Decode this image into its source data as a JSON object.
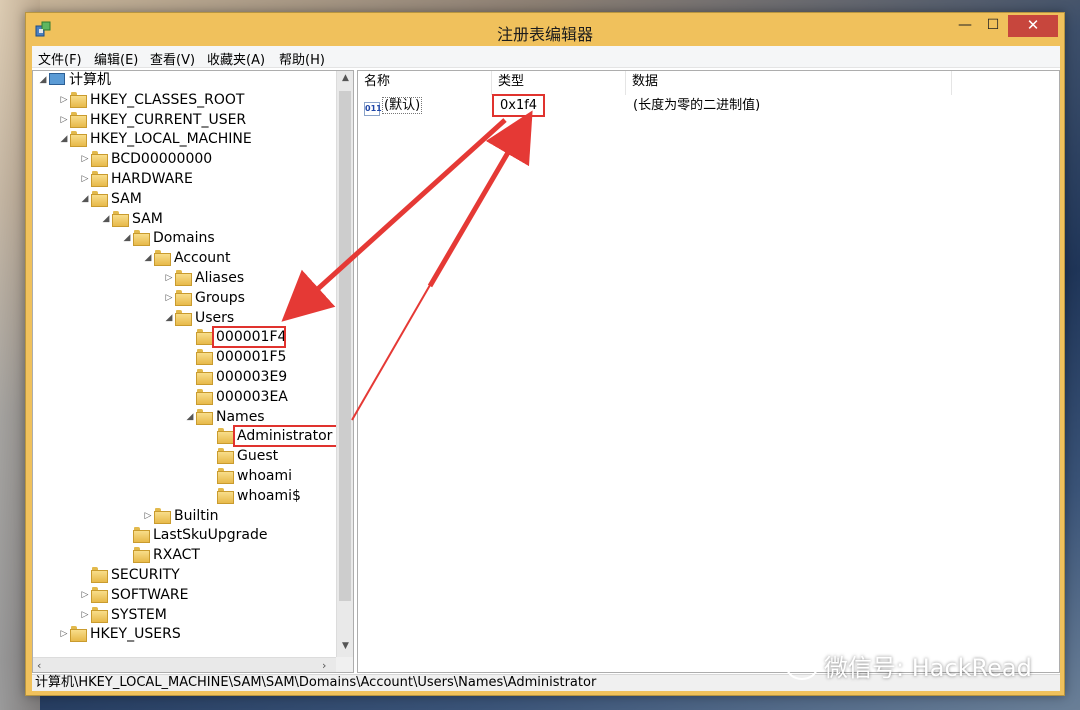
{
  "window": {
    "title": "注册表编辑器",
    "controls": {
      "minimize": "—",
      "maximize": "☐",
      "close": "✕"
    }
  },
  "menu": {
    "items": [
      "文件(F)",
      "编辑(E)",
      "查看(V)",
      "收藏夹(A)",
      "帮助(H)"
    ]
  },
  "tree": {
    "nodes": [
      {
        "label": "计算机",
        "level": 0,
        "expander": "◢",
        "icon": "computer-icon"
      },
      {
        "label": "HKEY_CLASSES_ROOT",
        "level": 1,
        "expander": "▷",
        "icon": "folder-icon"
      },
      {
        "label": "HKEY_CURRENT_USER",
        "level": 1,
        "expander": "▷",
        "icon": "folder-icon"
      },
      {
        "label": "HKEY_LOCAL_MACHINE",
        "level": 1,
        "expander": "◢",
        "icon": "folder-icon"
      },
      {
        "label": "BCD00000000",
        "level": 2,
        "expander": "▷",
        "icon": "folder-icon"
      },
      {
        "label": "HARDWARE",
        "level": 2,
        "expander": "▷",
        "icon": "folder-icon"
      },
      {
        "label": "SAM",
        "level": 2,
        "expander": "◢",
        "icon": "folder-icon"
      },
      {
        "label": "SAM",
        "level": 3,
        "expander": "◢",
        "icon": "folder-icon"
      },
      {
        "label": "Domains",
        "level": 4,
        "expander": "◢",
        "icon": "folder-icon"
      },
      {
        "label": "Account",
        "level": 5,
        "expander": "◢",
        "icon": "folder-icon"
      },
      {
        "label": "Aliases",
        "level": 6,
        "expander": "▷",
        "icon": "folder-icon"
      },
      {
        "label": "Groups",
        "level": 6,
        "expander": "▷",
        "icon": "folder-icon"
      },
      {
        "label": "Users",
        "level": 6,
        "expander": "◢",
        "icon": "folder-icon"
      },
      {
        "label": "000001F4",
        "level": 7,
        "expander": "",
        "icon": "folder-icon",
        "highlighted": true
      },
      {
        "label": "000001F5",
        "level": 7,
        "expander": "",
        "icon": "folder-icon"
      },
      {
        "label": "000003E9",
        "level": 7,
        "expander": "",
        "icon": "folder-icon"
      },
      {
        "label": "000003EA",
        "level": 7,
        "expander": "",
        "icon": "folder-icon"
      },
      {
        "label": "Names",
        "level": 7,
        "expander": "◢",
        "icon": "folder-icon"
      },
      {
        "label": "Administrator",
        "level": 8,
        "expander": "",
        "icon": "folder-icon",
        "highlighted": true,
        "selected": true
      },
      {
        "label": "Guest",
        "level": 8,
        "expander": "",
        "icon": "folder-icon"
      },
      {
        "label": "whoami",
        "level": 8,
        "expander": "",
        "icon": "folder-icon"
      },
      {
        "label": "whoami$",
        "level": 8,
        "expander": "",
        "icon": "folder-icon"
      },
      {
        "label": "Builtin",
        "level": 5,
        "expander": "▷",
        "icon": "folder-icon"
      },
      {
        "label": "LastSkuUpgrade",
        "level": 4,
        "expander": "",
        "icon": "folder-icon"
      },
      {
        "label": "RXACT",
        "level": 4,
        "expander": "",
        "icon": "folder-icon"
      },
      {
        "label": "SECURITY",
        "level": 2,
        "expander": "",
        "icon": "folder-icon"
      },
      {
        "label": "SOFTWARE",
        "level": 2,
        "expander": "▷",
        "icon": "folder-icon"
      },
      {
        "label": "SYSTEM",
        "level": 2,
        "expander": "▷",
        "icon": "folder-icon"
      },
      {
        "label": "HKEY_USERS",
        "level": 1,
        "expander": "▷",
        "icon": "folder-icon"
      }
    ]
  },
  "list": {
    "columns": [
      "名称",
      "类型",
      "数据"
    ],
    "rows": [
      {
        "name": "(默认)",
        "type": "0x1f4",
        "data": "(长度为零的二进制值)",
        "icon": "ab-icon",
        "icon_text": "011"
      }
    ]
  },
  "statusbar": {
    "path": "计算机\\HKEY_LOCAL_MACHINE\\SAM\\SAM\\Domains\\Account\\Users\\Names\\Administrator"
  },
  "watermark": {
    "text": "微信号: HackRead"
  },
  "colors": {
    "accent_highlight": "#e0332e",
    "titlebar": "#f0c15c",
    "close_button": "#c7463d"
  }
}
